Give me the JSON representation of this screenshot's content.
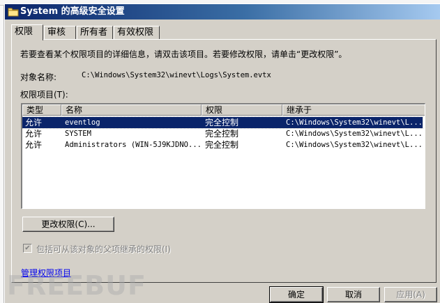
{
  "window": {
    "title": "System 的高级安全设置"
  },
  "tabs": [
    {
      "label": "权限",
      "active": true
    },
    {
      "label": "审核",
      "active": false
    },
    {
      "label": "所有者",
      "active": false
    },
    {
      "label": "有效权限",
      "active": false
    }
  ],
  "permissions": {
    "info_text": "若要查看某个权限项目的详细信息，请双击该项目。若要修改权限，请单击“更改权限”。",
    "object_name_label": "对象名称:",
    "object_name_value": "C:\\Windows\\System32\\winevt\\Logs\\System.evtx",
    "entries_label": "权限项目(T):",
    "columns": [
      "类型",
      "名称",
      "权限",
      "继承于"
    ],
    "rows": [
      {
        "type": "允许",
        "name": "eventlog",
        "permission": "完全控制",
        "inherited_from": "C:\\Windows\\System32\\winevt\\L...",
        "selected": true
      },
      {
        "type": "允许",
        "name": "SYSTEM",
        "permission": "完全控制",
        "inherited_from": "C:\\Windows\\System32\\winevt\\L...",
        "selected": false
      },
      {
        "type": "允许",
        "name": "Administrators (WIN-5J9KJDNO...",
        "permission": "完全控制",
        "inherited_from": "C:\\Windows\\System32\\winevt\\L...",
        "selected": false
      }
    ],
    "change_button": "更改权限(C)...",
    "inherit_checkbox_label": "包括可从该对象的父项继承的权限(I)",
    "inherit_checked": true,
    "inherit_checkbox_mark": "✔",
    "manage_link": "管理权限项目"
  },
  "footer": {
    "ok": "确定",
    "cancel": "取消",
    "apply": "应用(A)"
  },
  "watermark": "FREEBUF",
  "colors": {
    "titlebar_start": "#0a246a",
    "titlebar_end": "#a6caf0",
    "selection": "#0a246a",
    "face": "#d4d0c8",
    "link": "#0000ee"
  }
}
